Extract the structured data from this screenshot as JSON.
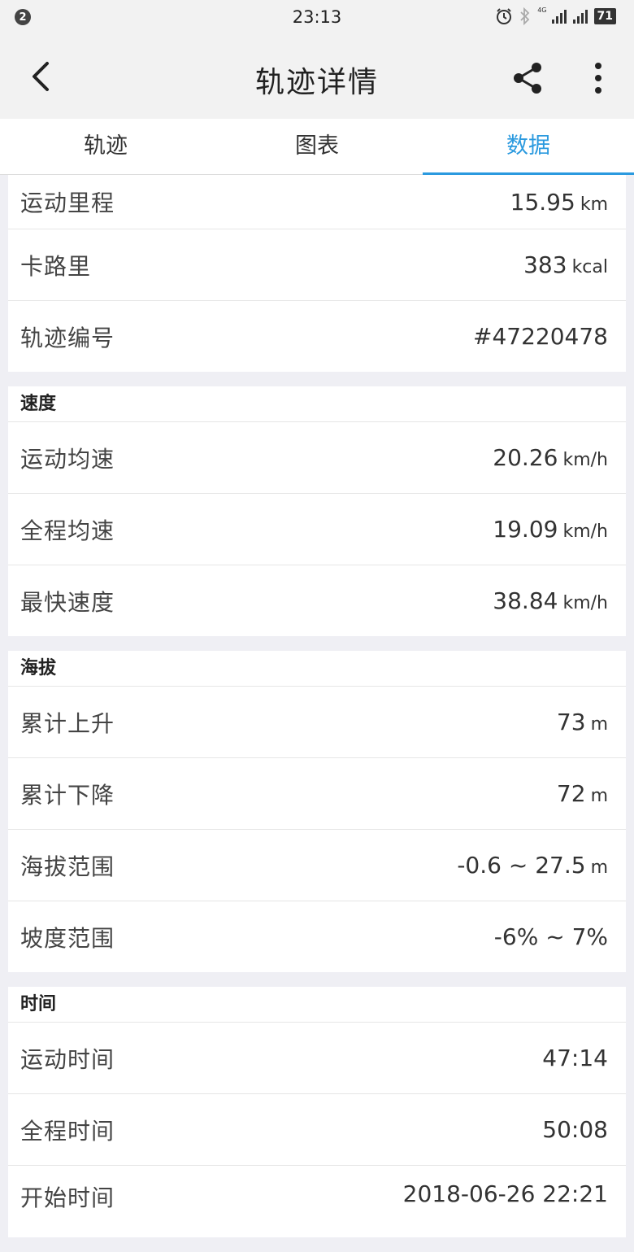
{
  "status_bar": {
    "notification_count": "2",
    "time": "23:13",
    "network": "4G",
    "battery": "71"
  },
  "app_bar": {
    "title": "轨迹详情"
  },
  "tabs": [
    {
      "label": "轨迹",
      "active": false
    },
    {
      "label": "图表",
      "active": false
    },
    {
      "label": "数据",
      "active": true
    }
  ],
  "accent_color": "#2b9adf",
  "summary": {
    "rows": [
      {
        "label": "运动里程",
        "value": "15.95",
        "unit": "km"
      },
      {
        "label": "卡路里",
        "value": "383",
        "unit": "kcal"
      },
      {
        "label": "轨迹编号",
        "value": "#47220478",
        "unit": ""
      }
    ]
  },
  "speed": {
    "title": "速度",
    "rows": [
      {
        "label": "运动均速",
        "value": "20.26",
        "unit": "km/h"
      },
      {
        "label": "全程均速",
        "value": "19.09",
        "unit": "km/h"
      },
      {
        "label": "最快速度",
        "value": "38.84",
        "unit": "km/h"
      }
    ]
  },
  "altitude": {
    "title": "海拔",
    "rows": [
      {
        "label": "累计上升",
        "value": "73",
        "unit": "m"
      },
      {
        "label": "累计下降",
        "value": "72",
        "unit": "m"
      },
      {
        "label": "海拔范围",
        "value": "-0.6 ~ 27.5",
        "unit": "m"
      },
      {
        "label": "坡度范围",
        "value": "-6% ~ 7%",
        "unit": ""
      }
    ]
  },
  "time": {
    "title": "时间",
    "rows": [
      {
        "label": "运动时间",
        "value": "47:14",
        "unit": ""
      },
      {
        "label": "全程时间",
        "value": "50:08",
        "unit": ""
      },
      {
        "label": "开始时间",
        "value": "2018-06-26 22:21",
        "unit": ""
      }
    ]
  }
}
